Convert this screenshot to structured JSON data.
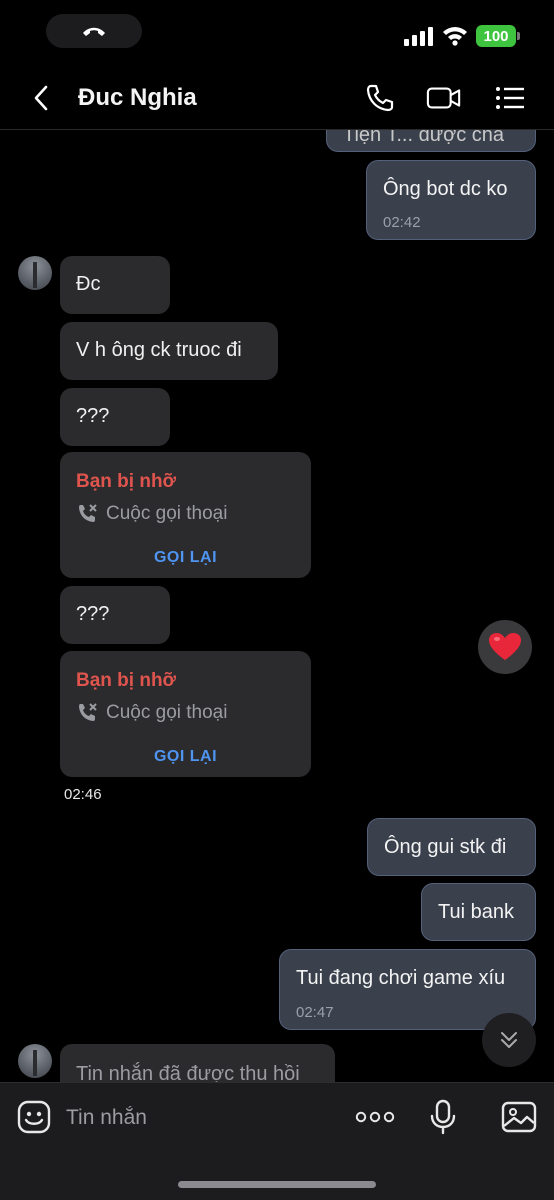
{
  "status_bar": {
    "battery": "100"
  },
  "header": {
    "contact_name": "Đuc Nghia"
  },
  "messages": {
    "partial_top": "Tiện T... được cha",
    "out1": {
      "text": "Ông bot dc ko",
      "time": "02:42"
    },
    "in1": {
      "text": "Đc"
    },
    "in2": {
      "text": "V h ông ck truoc đi"
    },
    "in3": {
      "text": "???"
    },
    "missed1": {
      "title": "Bạn bị nhỡ",
      "subtitle": "Cuộc gọi thoại",
      "action": "GỌI LẠI"
    },
    "in4": {
      "text": "???"
    },
    "missed2": {
      "title": "Bạn bị nhỡ",
      "subtitle": "Cuộc gọi thoại",
      "action": "GỌI LẠI"
    },
    "in_time": "02:46",
    "out2": {
      "text": "Ông gui stk đi"
    },
    "out3": {
      "text": "Tui bank"
    },
    "out4": {
      "text": "Tui đang chơi game xíu",
      "time": "02:47"
    },
    "recalled": {
      "text": "Tin nhắn đã được thu hồi"
    }
  },
  "input_bar": {
    "placeholder": "Tin nhắn"
  },
  "colors": {
    "missed_red": "#e0544e",
    "callback_blue": "#4e94f0",
    "out_bubble": "#3a414d",
    "in_bubble": "#2b2b2d"
  },
  "icons": [
    "phone-active-icon",
    "signal-icon",
    "wifi-icon",
    "battery-icon",
    "back-icon",
    "phone-icon",
    "video-icon",
    "menu-icon",
    "missed-call-icon",
    "heart-icon",
    "chevron-double-down-icon",
    "sticker-icon",
    "more-icon",
    "mic-icon",
    "image-icon"
  ]
}
